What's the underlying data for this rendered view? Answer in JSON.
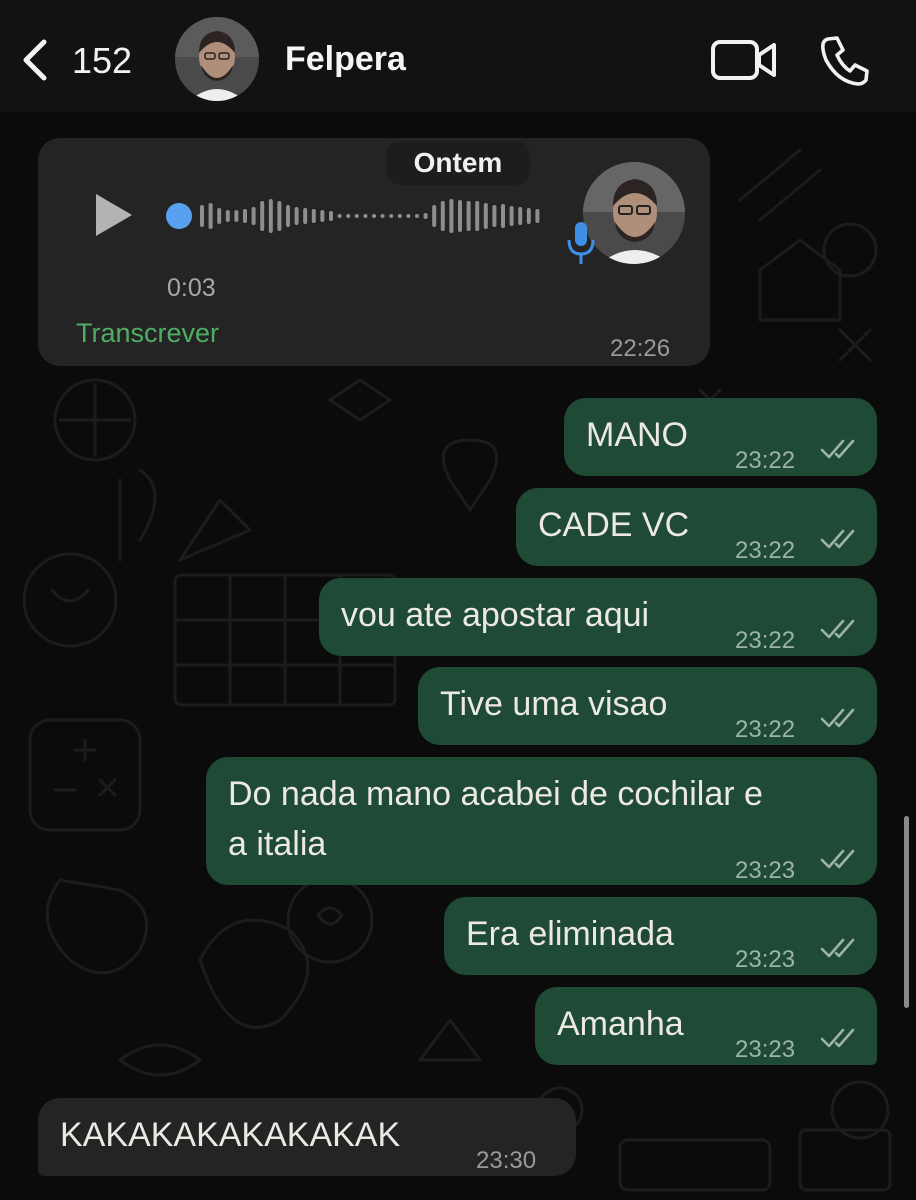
{
  "header": {
    "back_count": "152",
    "contact_name": "Felpera"
  },
  "date_divider": "Ontem",
  "voice_message": {
    "duration": "0:03",
    "transcribe_label": "Transcrever",
    "time": "22:26"
  },
  "messages": [
    {
      "direction": "out",
      "text": "MANO",
      "time": "23:22"
    },
    {
      "direction": "out",
      "text": "CADE VC",
      "time": "23:22"
    },
    {
      "direction": "out",
      "text": "vou ate apostar aqui",
      "time": "23:22"
    },
    {
      "direction": "out",
      "text": "Tive uma visao",
      "time": "23:22"
    },
    {
      "direction": "out",
      "text_line1": "Do nada mano acabei de cochilar e",
      "text_line2": "a italia",
      "time": "23:23"
    },
    {
      "direction": "out",
      "text": "Era eliminada",
      "time": "23:23"
    },
    {
      "direction": "out",
      "text": "Amanha",
      "time": "23:23"
    },
    {
      "direction": "in",
      "text": "KAKAKAKAKAKAKAK",
      "time": "23:30"
    }
  ],
  "icons": {
    "back": "chevron-left-icon",
    "video": "video-camera-icon",
    "call": "phone-icon",
    "play": "play-icon",
    "mic": "microphone-icon",
    "read": "double-check-icon"
  },
  "colors": {
    "outgoing_bubble": "#1f4a36",
    "incoming_bubble": "#242424",
    "transcribe_link": "#4fae63",
    "mic_blue": "#3f8fe6"
  }
}
